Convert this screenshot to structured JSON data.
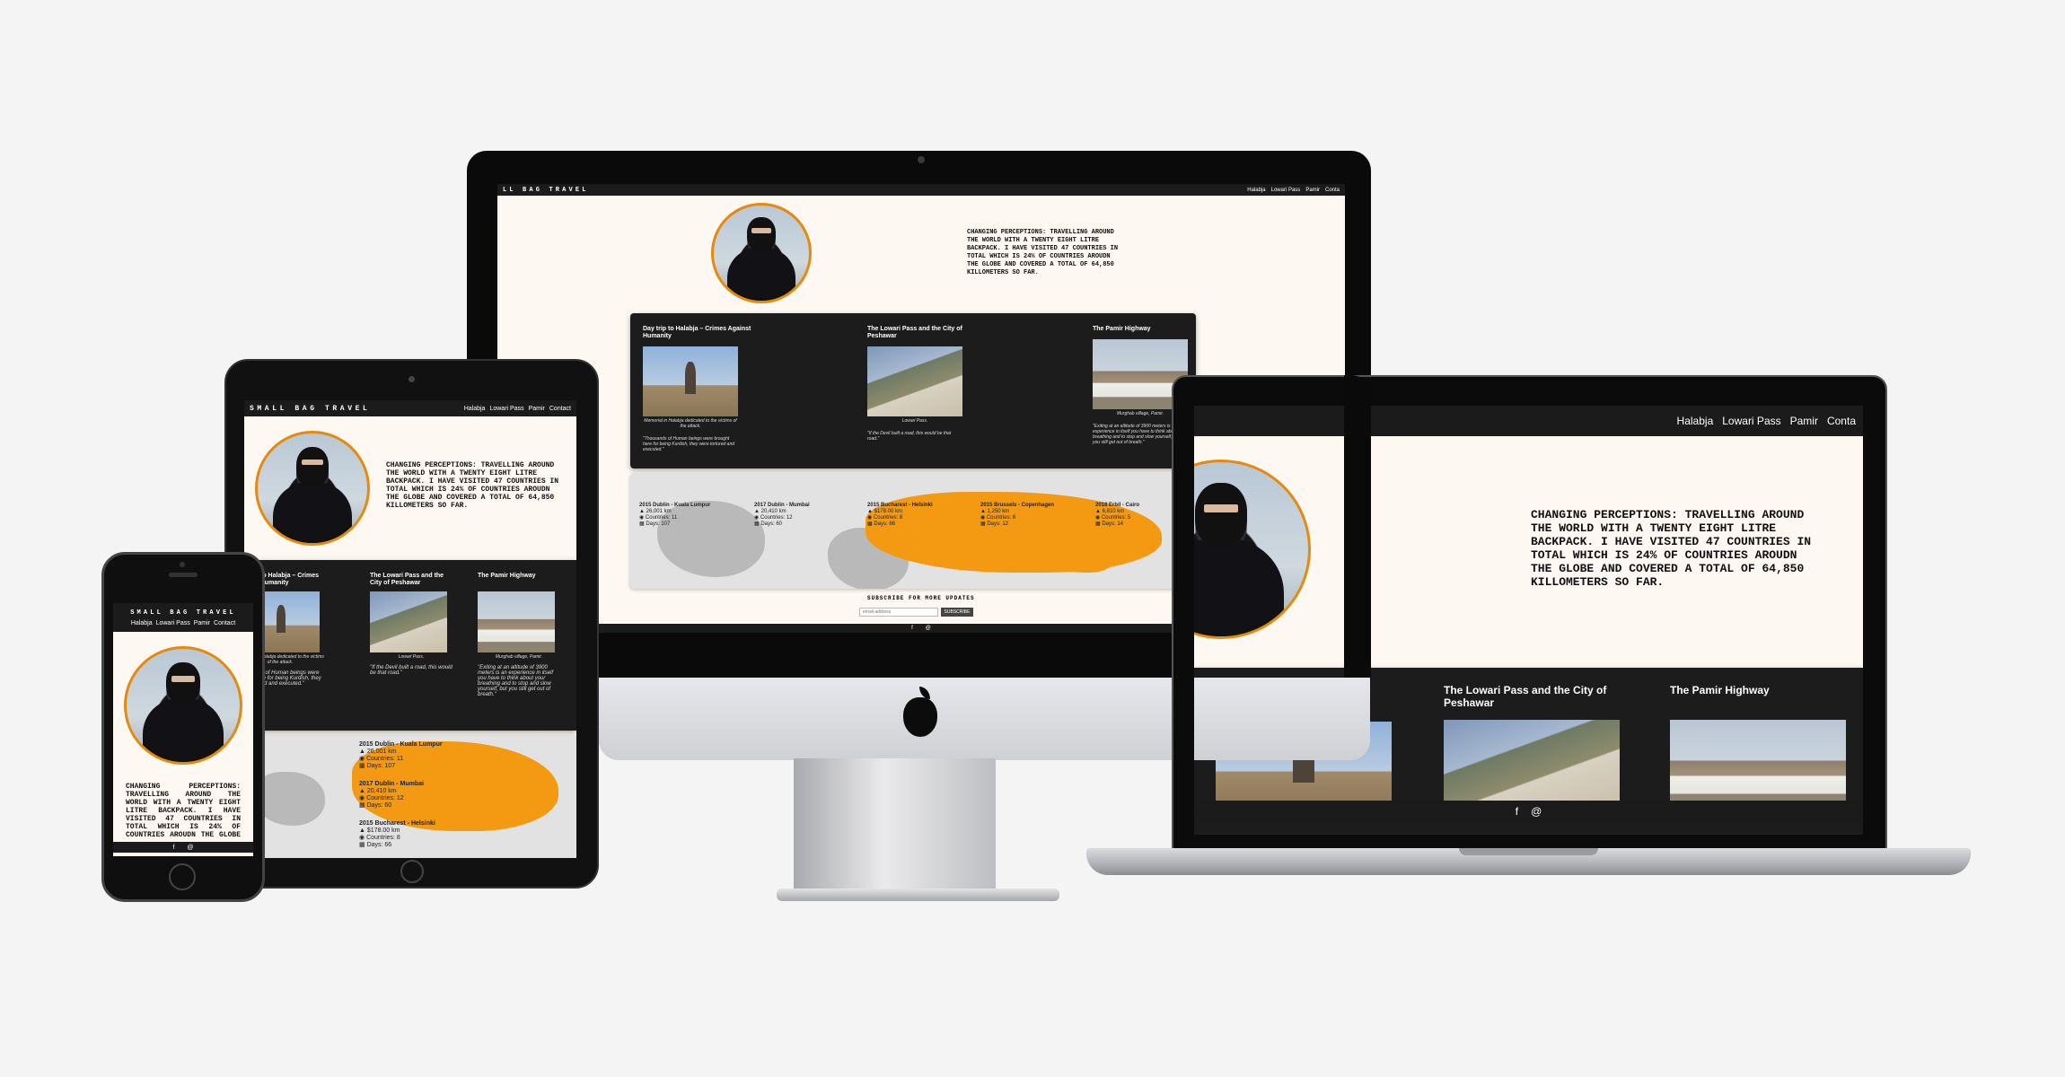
{
  "site": {
    "brand": "SMALL BAG TRAVEL",
    "brand_cropped_imac": "LL BAG TRAVEL",
    "nav": [
      "Halabja",
      "Lowari Pass",
      "Pamir",
      "Contact"
    ],
    "nav_cropped_last": "Conta",
    "intro": "CHANGING PERCEPTIONS: TRAVELLING AROUND THE WORLD WITH A TWENTY EIGHT LITRE BACKPACK. I HAVE VISITED 47 COUNTRIES IN TOTAL WHICH IS 24% OF COUNTRIES AROUDN THE GLOBE AND COVERED A TOTAL OF 64,850 KILLOMETERS SO FAR.",
    "cards": [
      {
        "title": "Day trip to Halabja – Crimes Against Humanity",
        "caption": "Memorial in Halabja dedicated to the victims of the attack.",
        "quote": "\"Thousands of Human beings were brought here for being Kurdish, they were tortured and executed.\""
      },
      {
        "title": "The Lowari Pass and the City of Peshawar",
        "caption": "Lowari Pass.",
        "quote": "\"If the Devil built a road, this would be that road.\""
      },
      {
        "title": "The Pamir Highway",
        "caption": "Murghab village, Pamir.",
        "quote": "\"Exiting at an altitude of 3900 meters is an experience in itself you have to think about your breathing and to stop and slow yourself, but you still get out of breath.\""
      }
    ],
    "trips": [
      {
        "route": "2015 Dublin - Kuala Lumpur",
        "km": "26,001 km",
        "countries": "Countries: 11",
        "days": "Days: 107"
      },
      {
        "route": "2017 Dublin - Mumbai",
        "km": "20,410 km",
        "countries": "Countries: 12",
        "days": "Days: 60"
      },
      {
        "route": "2015 Bucharest - Helsinki",
        "km": "$178.00 km",
        "countries": "Countries: 8",
        "days": "Days: 66"
      },
      {
        "route": "2015 Brussels - Copenhagen",
        "km": "1,250 km",
        "countries": "Countries: 6",
        "days": "Days: 12"
      },
      {
        "route": "2018 Erbil - Cairo",
        "km": "6,810 km",
        "countries": "Countries: 5",
        "days": "Days: 14"
      }
    ],
    "subscribe_title": "SUBSCRIBE FOR MORE UPDATES",
    "email_placeholder": "email address",
    "subscribe_button": "SUBSCRIBE",
    "footer_icons": [
      "facebook-icon",
      "email-icon"
    ],
    "footer_facebook": "f",
    "footer_email": "@"
  },
  "icons": {
    "km": "▲",
    "countries": "◉",
    "days": "▦"
  },
  "colors": {
    "accent": "#f39a12",
    "dark": "#1b1b1b",
    "page": "#fdf8f2"
  }
}
